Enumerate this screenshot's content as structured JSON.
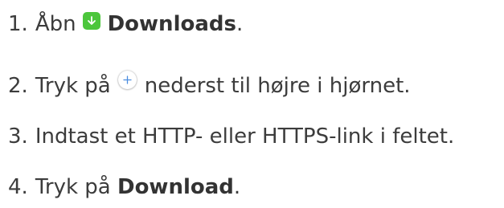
{
  "steps": [
    {
      "number": "1.",
      "text_before": "Åbn",
      "icon": "download-arrow-icon",
      "bold": "Downloads",
      "text_after": "."
    },
    {
      "number": "2.",
      "text_before": "Tryk på",
      "icon": "plus-circle-icon",
      "text_after": "nederst til højre i hjørnet."
    },
    {
      "number": "3.",
      "text": "Indtast et HTTP- eller HTTPS-link i feltet."
    },
    {
      "number": "4.",
      "text_before": "Tryk på",
      "bold": "Download",
      "text_after": "."
    }
  ],
  "colors": {
    "text": "#3c3c3c",
    "download_icon_bg": "#4cc63c",
    "plus_icon_color": "#4b8de0"
  }
}
